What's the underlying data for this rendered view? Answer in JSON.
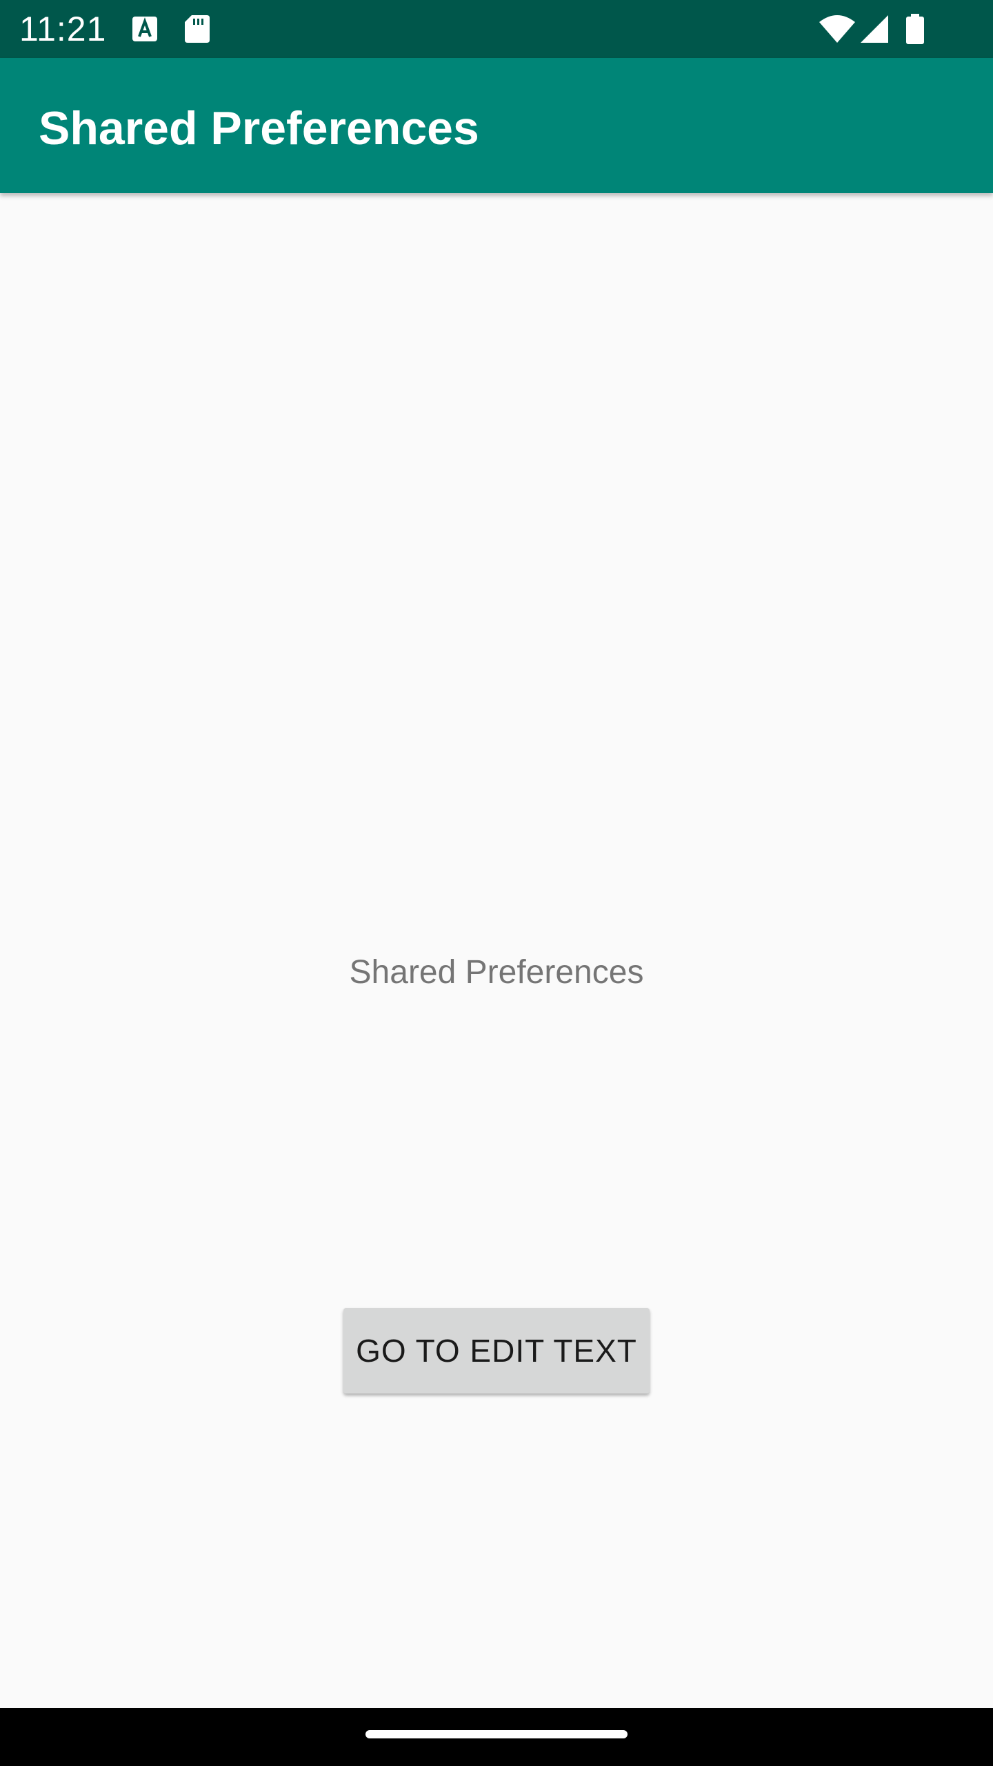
{
  "status_bar": {
    "time": "11:21",
    "left_icons": [
      "font-download-icon",
      "sd-card-icon"
    ],
    "right_icons": [
      "wifi-icon",
      "cell-signal-icon",
      "battery-icon"
    ],
    "background_color": "#00574b"
  },
  "app_bar": {
    "title": "Shared Preferences",
    "background_color": "#008577"
  },
  "main": {
    "label": "Shared Preferences",
    "button_label": "GO TO EDIT TEXT"
  },
  "nav_bar": {
    "home_indicator_icon": "home-indicator"
  }
}
